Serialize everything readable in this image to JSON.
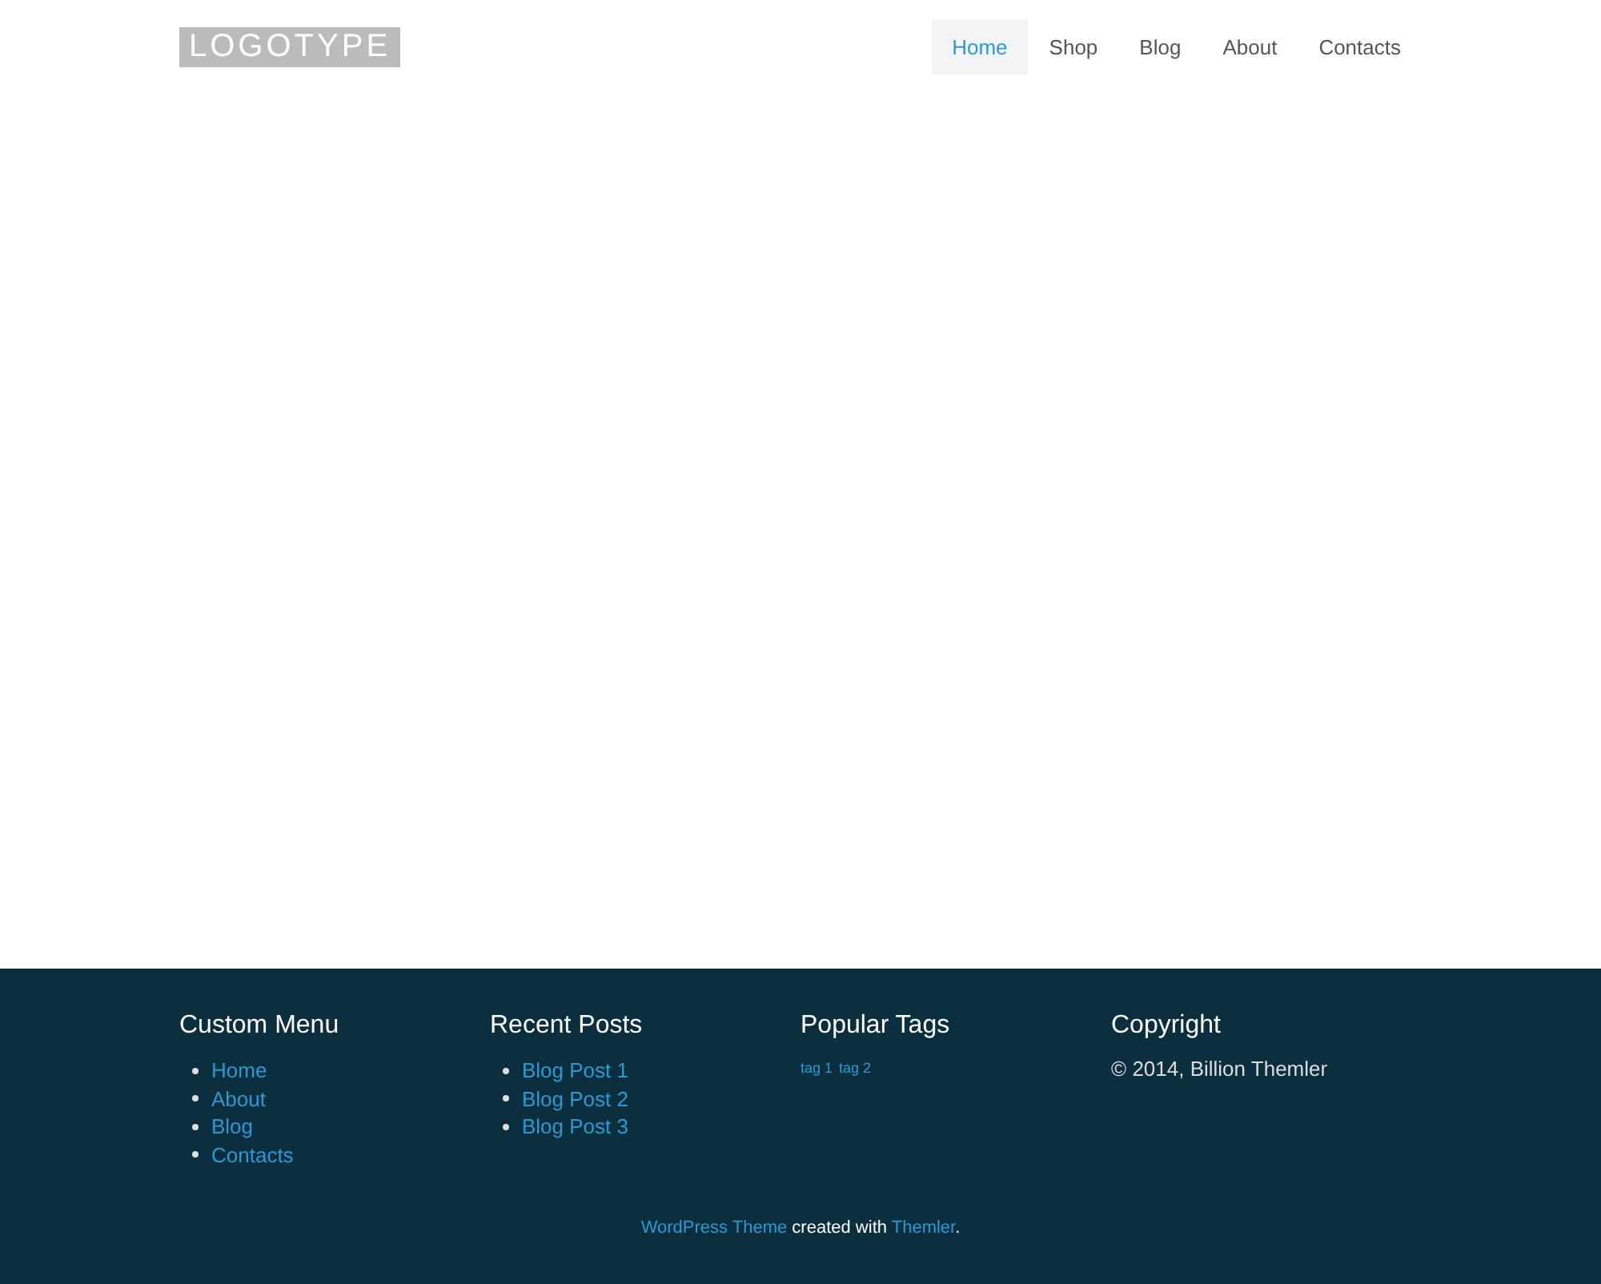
{
  "header": {
    "logo": "LOGOTYPE",
    "nav": [
      {
        "label": "Home",
        "selected": true
      },
      {
        "label": "Shop",
        "selected": false
      },
      {
        "label": "Blog",
        "selected": false
      },
      {
        "label": "About",
        "selected": false
      },
      {
        "label": "Contacts",
        "selected": false
      }
    ]
  },
  "footer": {
    "widgets": [
      {
        "kind": "links",
        "title": "Custom Menu",
        "items": [
          "Home",
          "About",
          "Blog",
          "Contacts"
        ]
      },
      {
        "kind": "links",
        "title": "Recent Posts",
        "items": [
          "Blog Post 1",
          "Blog Post 2",
          "Blog Post 3"
        ]
      },
      {
        "kind": "tags",
        "title": "Popular Tags",
        "items": [
          "tag 1",
          "tag 2"
        ]
      },
      {
        "kind": "text",
        "title": "Copyright",
        "text": "© 2014, Billion Themler"
      }
    ],
    "credit": [
      {
        "kind": "link",
        "text": "WordPress Theme"
      },
      {
        "kind": "text",
        "text": " created with "
      },
      {
        "kind": "link",
        "text": "Themler"
      },
      {
        "kind": "text",
        "text": "."
      }
    ]
  }
}
